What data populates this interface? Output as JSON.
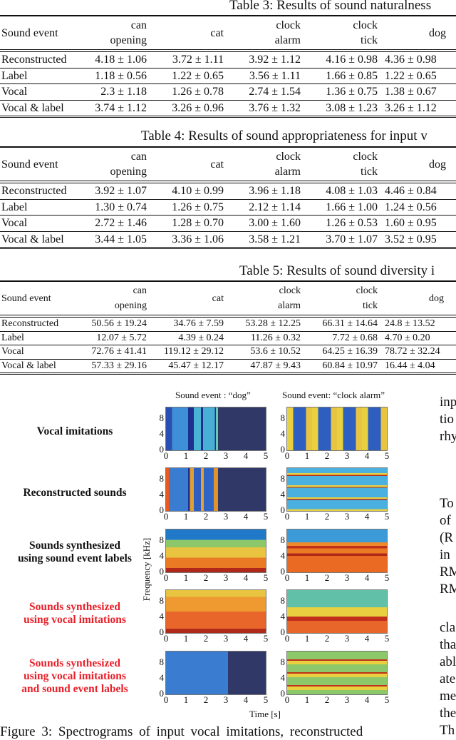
{
  "tables": [
    {
      "caption": "Table 3: Results of sound naturalness",
      "header": [
        "Sound event",
        "can\nopening",
        "cat",
        "clock\nalarm",
        "clock\ntick",
        "dog"
      ],
      "rows": [
        {
          "label": "Reconstructed",
          "cells": [
            "4.18 ± 1.06",
            "3.72 ± 1.11",
            "3.92 ± 1.12",
            "4.16 ± 0.98",
            "4.36 ± 0.98"
          ]
        },
        {
          "label": "Label",
          "cells": [
            "1.18 ± 0.56",
            "1.22 ± 0.65",
            "3.56 ± 1.11",
            "1.66 ± 0.85",
            "1.22 ± 0.65"
          ]
        },
        {
          "label": "Vocal",
          "cells": [
            "2.3 ± 1.18",
            "1.26 ± 0.78",
            "2.74 ± 1.54",
            "1.36 ± 0.75",
            "1.38 ± 0.67"
          ]
        },
        {
          "label": "Vocal & label",
          "cells": [
            "3.74 ± 1.12",
            "3.26 ± 0.96",
            "3.76 ± 1.32",
            "3.08 ± 1.23",
            "3.26 ± 1.12"
          ]
        }
      ]
    },
    {
      "caption": "Table 4: Results of sound appropriateness for input v",
      "header": [
        "Sound event",
        "can\nopening",
        "cat",
        "clock\nalarm",
        "clock\ntick",
        "dog"
      ],
      "rows": [
        {
          "label": "Reconstructed",
          "cells": [
            "3.92 ± 1.07",
            "4.10 ± 0.99",
            "3.96 ± 1.18",
            "4.08 ± 1.03",
            "4.46 ± 0.84"
          ]
        },
        {
          "label": "Label",
          "cells": [
            "1.30 ± 0.74",
            "1.26 ± 0.75",
            "2.12 ± 1.14",
            "1.66 ± 1.00",
            "1.24 ± 0.56"
          ]
        },
        {
          "label": "Vocal",
          "cells": [
            "2.72 ± 1.46",
            "1.28 ± 0.70",
            "3.00 ± 1.60",
            "1.26 ± 0.53",
            "1.60 ± 0.95"
          ]
        },
        {
          "label": "Vocal & label",
          "cells": [
            "3.44 ± 1.05",
            "3.36 ± 1.06",
            "3.58 ± 1.21",
            "3.70 ± 1.07",
            "3.52 ± 0.95"
          ]
        }
      ]
    },
    {
      "caption": "Table 5: Results of sound diversity i",
      "header": [
        "Sound event",
        "can\nopening",
        "cat",
        "clock\nalarm",
        "clock\ntick",
        "dog"
      ],
      "rows": [
        {
          "label": "Reconstructed",
          "cells": [
            "50.56 ± 19.24",
            "34.76 ± 7.59",
            "53.28 ± 12.25",
            "66.31 ± 14.64",
            "24.8 ± 13.52"
          ]
        },
        {
          "label": "Label",
          "cells": [
            "12.07 ± 5.72",
            "4.39 ± 0.24",
            "11.26 ± 0.32",
            "7.72 ± 0.68",
            "4.70 ± 0.20"
          ]
        },
        {
          "label": "Vocal",
          "cells": [
            "72.76 ± 41.41",
            "119.12 ± 29.12",
            "53.6 ± 10.52",
            "64.25 ± 16.39",
            "78.72 ± 32.24"
          ]
        },
        {
          "label": "Vocal & label",
          "cells": [
            "57.33 ± 29.16",
            "45.47 ± 12.17",
            "47.87 ± 9.43",
            "60.84 ± 10.97",
            "16.44 ± 4.04"
          ]
        }
      ]
    }
  ],
  "figure": {
    "column_titles": [
      "Sound event : “dog”",
      "Sound event: “clock alarm”"
    ],
    "row_labels": [
      {
        "text": "Vocal imitations",
        "highlight": false
      },
      {
        "text": "Reconstructed sounds",
        "highlight": false
      },
      {
        "text": "Sounds synthesized\nusing sound event labels",
        "highlight": false
      },
      {
        "text": "Sounds synthesized\nusing vocal imitations",
        "highlight": true
      },
      {
        "text": "Sounds synthesized\nusing vocal imitations\nand sound event labels",
        "highlight": true
      }
    ],
    "y_axis_label": "Frequency [kHz]",
    "x_axis_label": "Time [s]",
    "y_ticks": [
      "0",
      "4",
      "8"
    ],
    "x_ticks": [
      "0",
      "1",
      "2",
      "3",
      "4",
      "5"
    ],
    "highlight_color": "#e8202a",
    "caption": "Figure 3: Spectrograms of input vocal imitations, reconstructed"
  },
  "side_column": {
    "fragments": [
      "inp",
      "tio",
      "rhy",
      "",
      "",
      "To",
      "of",
      "(R",
      "in",
      "RM",
      "RM",
      "",
      "cla",
      "tha",
      "abl",
      "ate",
      "me",
      "the",
      "Th"
    ]
  }
}
